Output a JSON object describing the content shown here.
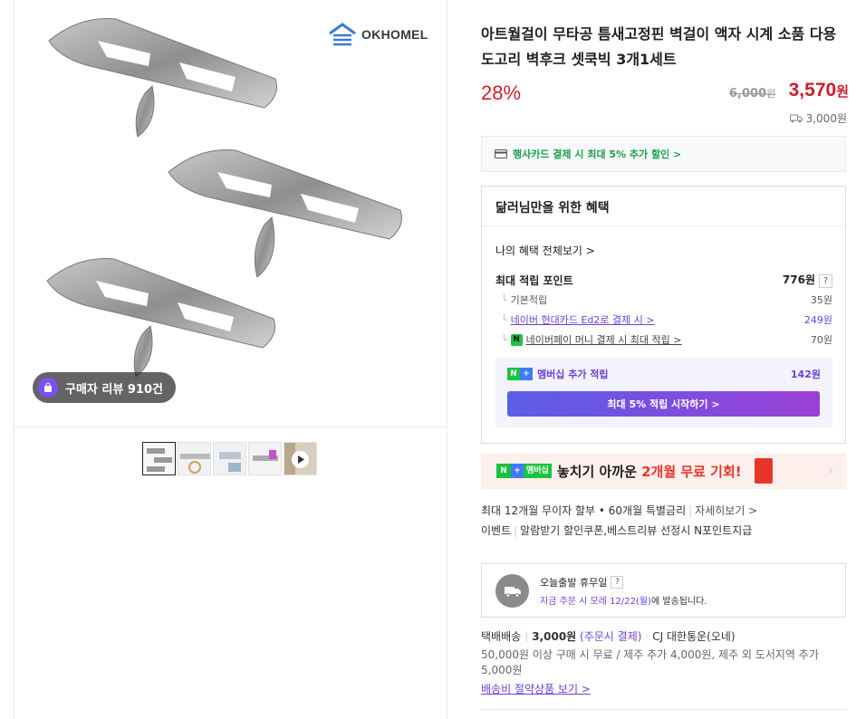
{
  "gallery": {
    "brand": "OKHOMEL",
    "review_badge": "구매자 리뷰 910건",
    "thumbnails": [
      "hook-clips",
      "hook-ring",
      "hook-wall",
      "hook-hand",
      "hook-video"
    ]
  },
  "product": {
    "title": "아트월걸이 무타공 틈새고정핀 벽걸이 액자 시계 소품 다용도고리 벽후크 셋쿡빅 3개1세트",
    "discount": "28%",
    "original_price": "6,000",
    "sale_price": "3,570",
    "currency": "원",
    "shipping_fee": "3,000원"
  },
  "card_benefit": "행사카드 결제 시 최대 5% 추가 할인 >",
  "benefits": {
    "heading": "닮러님만을 위한 혜택",
    "all_link": "나의 혜택 전체보기 >",
    "max_points_label": "최대 적립 포인트",
    "max_points_value": "776원",
    "help": "?",
    "rows": [
      {
        "label": "기본적립",
        "value": "35원"
      },
      {
        "label": "네이버 현대카드 Ed2로 결제 시 >",
        "value": "249원"
      },
      {
        "label": "네이버페이 머니 결제 시 최대 적립 >",
        "value": "70원"
      }
    ],
    "membership_label": "멤버십 추가 적립",
    "membership_value": "142원",
    "start_button": "최대 5% 적립 시작하기 >"
  },
  "promo": {
    "badge": "멤버십",
    "text_before": "놓치기 아까운 ",
    "text_highlight": "2개월 무료 기회!"
  },
  "installment": {
    "text": "최대 12개월 무이자 할부 • 60개월 특별금리",
    "link": "자세히보기 >"
  },
  "events": {
    "label": "이벤트",
    "text": "알람받기 할인쿠폰,베스트리뷰 선정시 N포인트지급"
  },
  "delivery": {
    "title": "오늘출발 휴무일",
    "help": "?",
    "sub_highlight": "지금 주문 시 모레 12/22(월)",
    "sub_rest": "에 발송됩니다."
  },
  "shipping": {
    "method": "택배배송",
    "fee": "3,000원",
    "payment": "(주문시 결제)",
    "carrier": "CJ 대한통운(오네)",
    "note": "50,000원 이상 구매 시 무료 / 제주 추가 4,000원, 제주 외 도서지역 추가 5,000원",
    "save_link": "배송비 절약상품 보기 >"
  },
  "colors": {
    "price_red": "#cf1c2b",
    "purple": "#6b3fd6",
    "naver_green": "#19c43f"
  }
}
